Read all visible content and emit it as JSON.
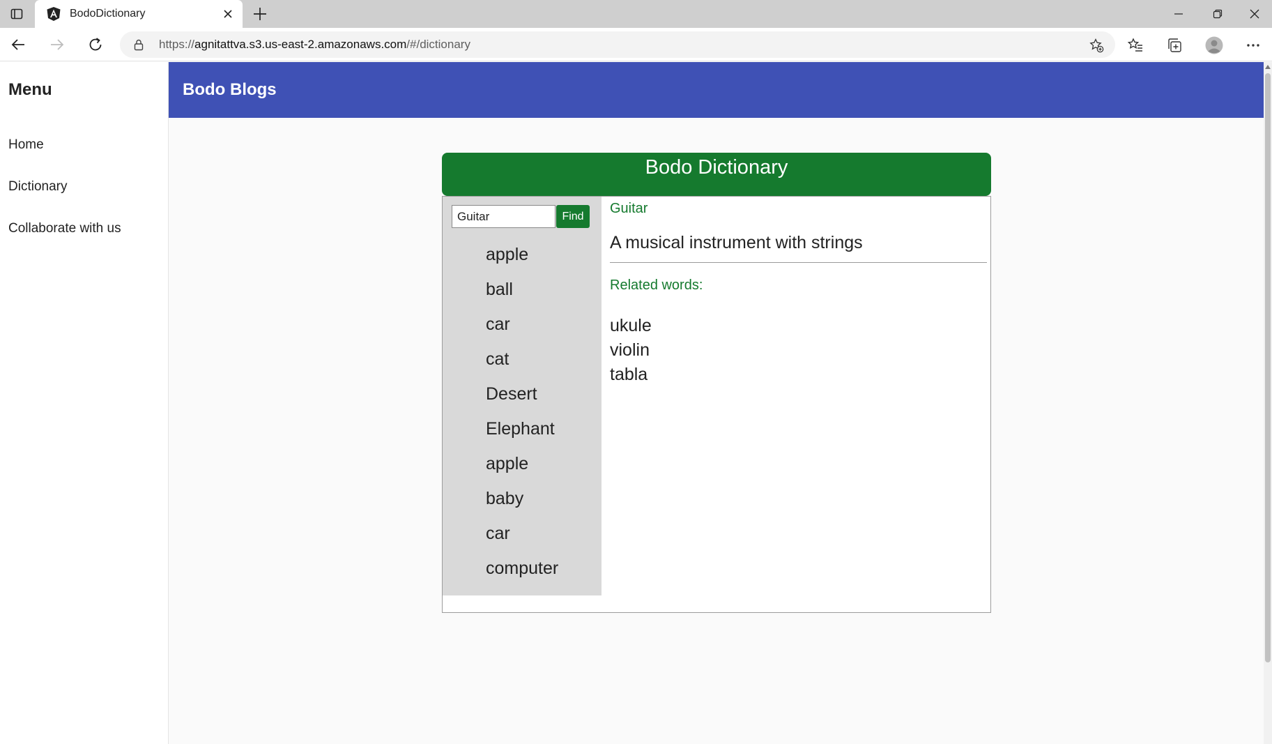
{
  "browser": {
    "tab_title": "BodoDictionary",
    "url_prefix": "https://",
    "url_host": "agnitattva.s3.us-east-2.amazonaws.com",
    "url_path": "/#/dictionary"
  },
  "sidenav": {
    "title": "Menu",
    "items": [
      {
        "label": "Home"
      },
      {
        "label": "Dictionary"
      },
      {
        "label": "Collaborate with us"
      }
    ]
  },
  "header": {
    "brand": "Bodo Blogs",
    "color": "#3f51b5"
  },
  "dictionary": {
    "title": "Bodo Dictionary",
    "accent": "#157a2e",
    "search": {
      "value": "Guitar",
      "button_label": "Find"
    },
    "words": [
      "apple",
      "ball",
      "car",
      "cat",
      "Desert",
      "Elephant",
      "apple",
      "baby",
      "car",
      "computer"
    ],
    "selected": {
      "word": "Guitar",
      "meaning": "A musical instrument with strings",
      "related_label": "Related words:",
      "related": [
        "ukule",
        "violin",
        "tabla"
      ]
    }
  }
}
